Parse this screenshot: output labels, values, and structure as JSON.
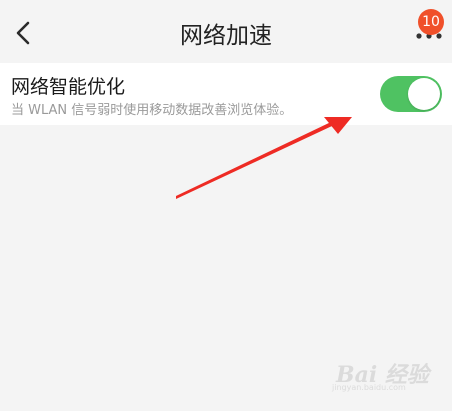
{
  "header": {
    "title": "网络加速",
    "badge_count": "10"
  },
  "setting": {
    "label": "网络智能优化",
    "description": "当 WLAN 信号弱时使用移动数据改善浏览体验。",
    "toggle_on": true
  },
  "watermark": {
    "text": "Bai 经验",
    "sub": "jingyan.baidu.com"
  },
  "colors": {
    "toggle_on": "#4fc262",
    "badge": "#f0502a",
    "arrow": "#ee2b24"
  },
  "icons": {
    "back": "chevron-left-icon",
    "more": "more-dots-icon",
    "annotation": "red-arrow-icon"
  }
}
